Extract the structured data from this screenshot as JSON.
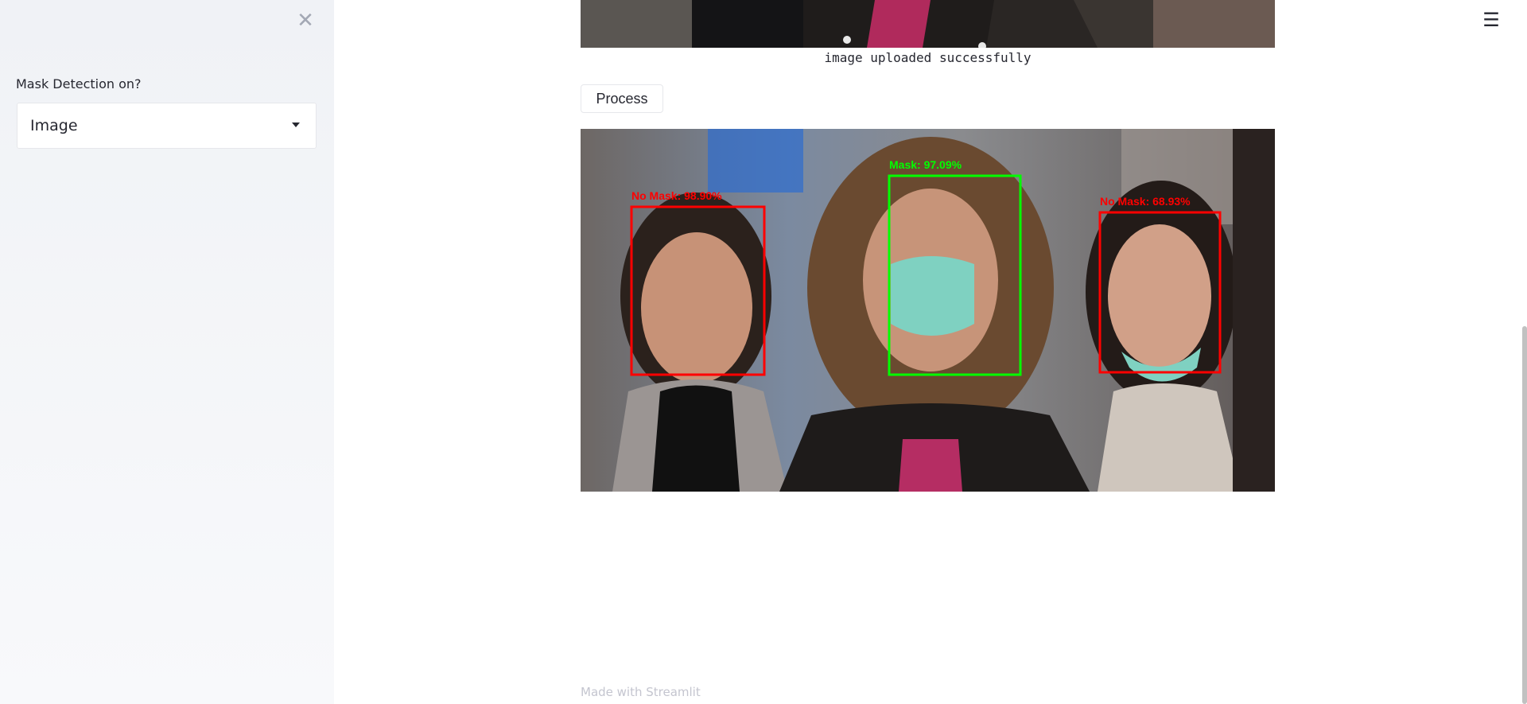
{
  "sidebar": {
    "close_icon": "close-icon",
    "label": "Mask Detection on?",
    "select": {
      "value": "Image",
      "arrow_icon": "caret-down-icon"
    }
  },
  "header": {
    "menu_icon": "hamburger-menu-icon",
    "menu_glyph": "☰"
  },
  "main": {
    "caption": "image uploaded successfully",
    "process_button": "Process",
    "detections": [
      {
        "label": "No Mask: 98.90%",
        "color": "#ff0000"
      },
      {
        "label": "Mask: 97.09%",
        "color": "#00ff00"
      },
      {
        "label": "No Mask: 68.93%",
        "color": "#ff0000"
      }
    ]
  },
  "footer": {
    "text": "Made with Streamlit"
  }
}
